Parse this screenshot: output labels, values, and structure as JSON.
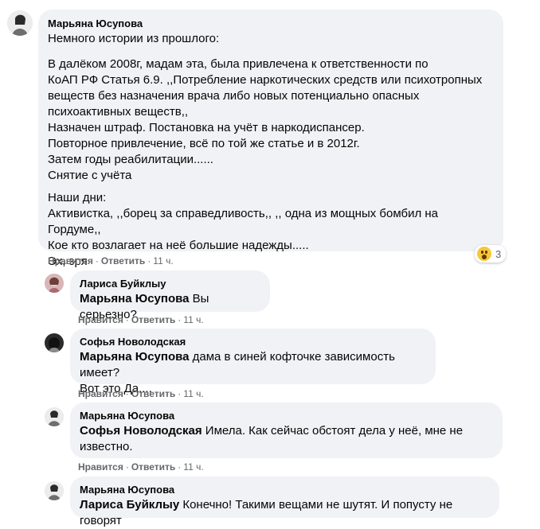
{
  "comments": [
    {
      "author": "Марьяна Юсупова",
      "paragraphs": [
        [
          "Немного истории из прошлого:"
        ],
        [
          "В далёком 2008г, мадам эта, была привлечена к ответственности по",
          "КоАП РФ Статья 6.9. ,,Потребление наркотических средств или психотропных",
          "веществ без назначения врача либо новых потенциально опасных",
          "психоактивных веществ,,",
          "Назначен штраф. Постановка на учёт в наркодиспансер.",
          "Повторное привлечение, всё по той же статье и в 2012г.",
          "Затем годы реабилитации......",
          "Снятие с учёта"
        ],
        [
          "Наши дни:",
          "Активистка, ,,борец за справедливость,, ,, одна из мощных бомбил на Гордуме,,",
          "Кое кто возлагает на неё большие надежды.....",
          "Эх, зря"
        ]
      ],
      "like": "Нравится",
      "reply": "Ответить",
      "time": "11 ч.",
      "reaction_count": "3",
      "reaction_icon": "wow-emoji-icon"
    }
  ],
  "replies": [
    {
      "author": "Лариса Буйклыу",
      "mention": "Марьяна Юсупова",
      "lines": [
        " Вы серьезно?"
      ],
      "like": "Нравится",
      "reply": "Ответить",
      "time": "11 ч."
    },
    {
      "author": "Софья Новолодская",
      "mention": "Марьяна Юсупова",
      "lines": [
        " дама в синей кофточке зависимость имеет?",
        "Вот это Да...."
      ],
      "like": "Нравится",
      "reply": "Ответить",
      "time": "11 ч."
    },
    {
      "author": "Марьяна Юсупова",
      "mention": "Софья Новолодская",
      "lines": [
        " Имела. Как сейчас обстоят дела у неё, мне не",
        "известно."
      ],
      "like": "Нравится",
      "reply": "Ответить",
      "time": "11 ч."
    },
    {
      "author": "Марьяна Юсупова",
      "mention": "Лариса Буйклыу",
      "lines": [
        " Конечно! Такими вещами не шутят. И попусту не говорят"
      ],
      "like": "",
      "reply": "",
      "time": ""
    }
  ],
  "colors": {
    "bubble": "#f0f2f5",
    "meta_text": "#65676b",
    "text": "#050505"
  }
}
